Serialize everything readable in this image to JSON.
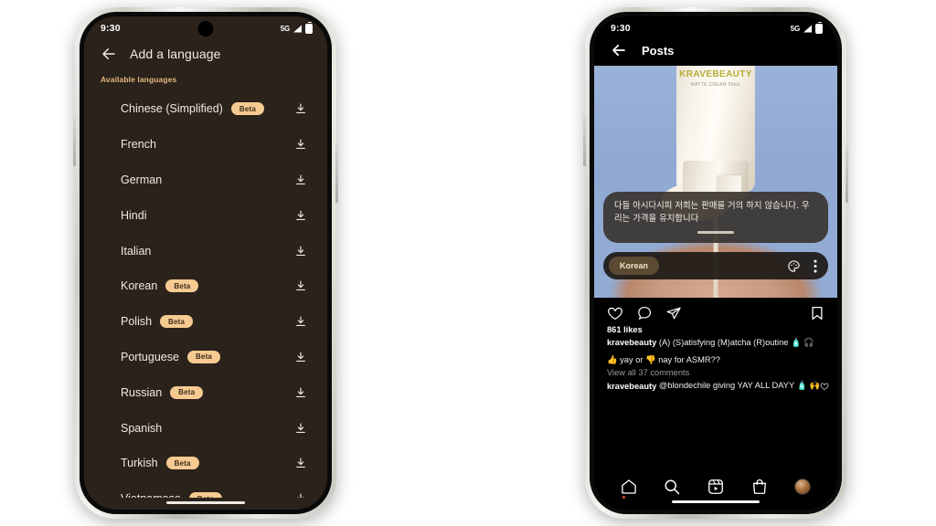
{
  "left_phone": {
    "status_bar": {
      "time": "9:30",
      "network": "5G",
      "signal_icon": "signal-bars-icon",
      "battery_icon": "battery-icon"
    },
    "app_bar": {
      "back_icon": "back-arrow-icon",
      "title": "Add a language"
    },
    "section_label": "Available languages",
    "languages": [
      {
        "name": "Chinese (Simplified)",
        "badge": "Beta",
        "action_icon": "download-icon"
      },
      {
        "name": "French",
        "badge": "",
        "action_icon": "download-icon"
      },
      {
        "name": "German",
        "badge": "",
        "action_icon": "download-icon"
      },
      {
        "name": "Hindi",
        "badge": "",
        "action_icon": "download-icon"
      },
      {
        "name": "Italian",
        "badge": "",
        "action_icon": "download-icon"
      },
      {
        "name": "Korean",
        "badge": "Beta",
        "action_icon": "download-icon"
      },
      {
        "name": "Polish",
        "badge": "Beta",
        "action_icon": "download-icon"
      },
      {
        "name": "Portuguese",
        "badge": "Beta",
        "action_icon": "download-icon"
      },
      {
        "name": "Russian",
        "badge": "Beta",
        "action_icon": "download-icon"
      },
      {
        "name": "Spanish",
        "badge": "",
        "action_icon": "download-icon"
      },
      {
        "name": "Turkish",
        "badge": "Beta",
        "action_icon": "download-icon"
      },
      {
        "name": "Vietnamese",
        "badge": "Beta",
        "action_icon": "download-icon"
      }
    ],
    "colors": {
      "background": "#2b221c",
      "text": "#f0eae4",
      "section_label": "#e6b87e",
      "badge_bg": "#f6ca91",
      "badge_text": "#3b2d1d"
    }
  },
  "right_phone": {
    "status_bar": {
      "time": "9:30",
      "network": "5G",
      "signal_icon": "signal-bars-icon",
      "battery_icon": "battery-icon"
    },
    "app_bar": {
      "back_icon": "back-arrow-icon",
      "title": "Posts"
    },
    "media": {
      "brand_text": "KRAVEBEAUTY",
      "brand_subtext": "MATTE CREAM 50mL"
    },
    "caption_overlay": {
      "text": "다들 아시다시피 저희는 판매를 거의 하지 않습니다. 우리는 가격을 유지합니다",
      "language_chip": "Korean",
      "palette_icon": "palette-icon",
      "more_icon": "more-vertical-icon"
    },
    "actions": {
      "like_icon": "heart-icon",
      "comment_icon": "comment-bubble-icon",
      "share_icon": "share-paperplane-icon",
      "save_icon": "bookmark-icon"
    },
    "post": {
      "likes": "861 likes",
      "username": "kravebeauty",
      "caption": "(A) (S)atisfying (M)atcha (R)outine 🧴 🎧",
      "caption_line2": "👍 yay or 👎 nay for ASMR??",
      "view_comments": "View all 37 comments",
      "comment_username": "kravebeauty",
      "comment_text": "@blondechile giving YAY ALL DAYY 🧴 🙌",
      "comment_like_icon": "heart-icon"
    },
    "bottom_nav": [
      {
        "name": "home",
        "icon": "home-icon"
      },
      {
        "name": "search",
        "icon": "search-icon"
      },
      {
        "name": "reels",
        "icon": "reels-icon"
      },
      {
        "name": "shop",
        "icon": "shopping-bag-icon"
      },
      {
        "name": "profile",
        "icon": "avatar-icon"
      }
    ],
    "colors": {
      "background": "#000000",
      "text": "#efefef",
      "muted": "#9a9a9a",
      "chip_bg": "#5c4a33"
    }
  }
}
